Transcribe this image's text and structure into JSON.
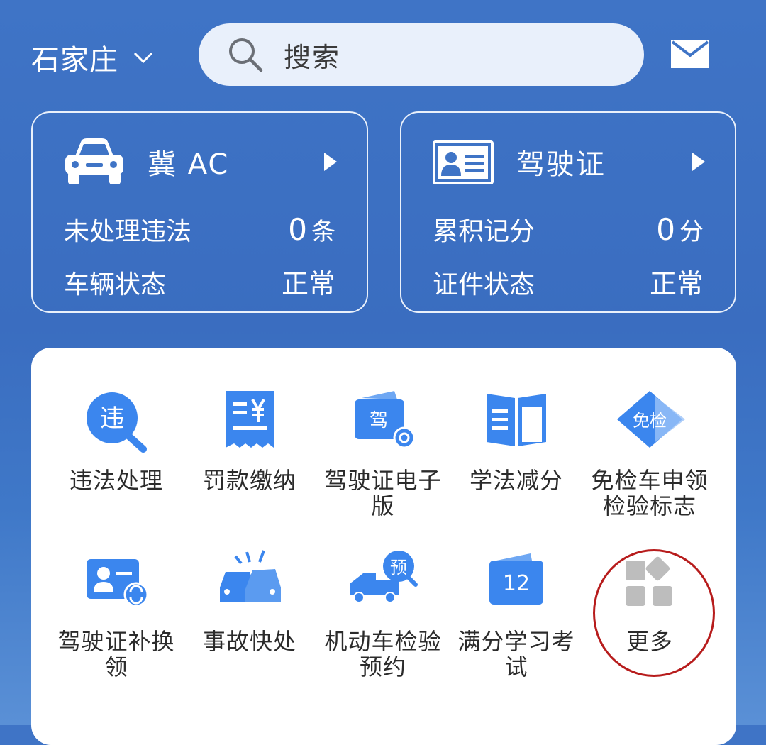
{
  "header": {
    "city": "石家庄",
    "search_placeholder": "搜索"
  },
  "cards": {
    "vehicle": {
      "title": "冀 AC",
      "row1_label": "未处理违法",
      "row1_value": "0",
      "row1_unit": "条",
      "row2_label": "车辆状态",
      "row2_value": "正常"
    },
    "license": {
      "title": "驾驶证",
      "row1_label": "累积记分",
      "row1_value": "0",
      "row1_unit": "分",
      "row2_label": "证件状态",
      "row2_value": "正常"
    }
  },
  "services": [
    {
      "label": "违法处理",
      "icon": "violation-search-icon"
    },
    {
      "label": "罚款缴纳",
      "icon": "receipt-yuan-icon"
    },
    {
      "label": "驾驶证电子版",
      "icon": "e-license-icon"
    },
    {
      "label": "学法减分",
      "icon": "open-book-icon"
    },
    {
      "label": "免检车申领检验标志",
      "icon": "exempt-badge-icon",
      "badge": "免检"
    },
    {
      "label": "驾驶证补换领",
      "icon": "license-renew-icon"
    },
    {
      "label": "事故快处",
      "icon": "car-accident-icon"
    },
    {
      "label": "机动车检验预约",
      "icon": "truck-appointment-icon",
      "badge": "预"
    },
    {
      "label": "满分学习考试",
      "icon": "calendar-12-icon",
      "badge": "12"
    },
    {
      "label": "更多",
      "icon": "more-grid-icon"
    }
  ],
  "icon_badges": {
    "violation": "违",
    "license_e": "驾"
  },
  "colors": {
    "primary_blue": "#3b78e7",
    "highlight_ring": "#b71c1c"
  }
}
